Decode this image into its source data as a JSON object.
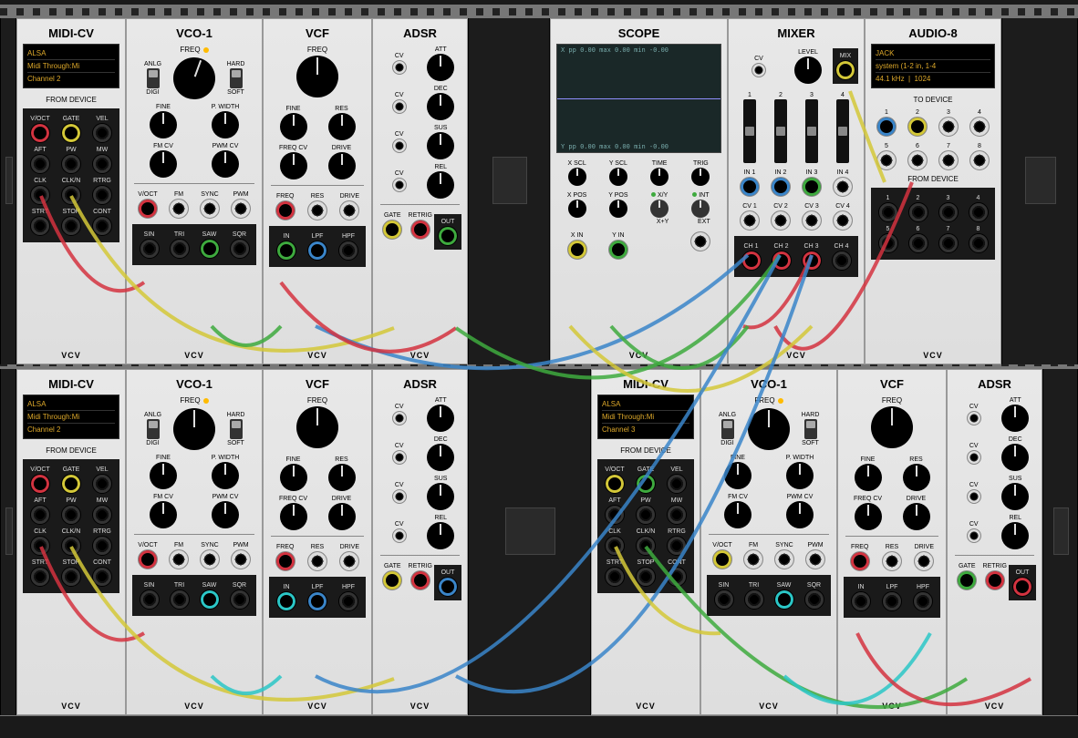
{
  "brand": "VCV",
  "labels": {
    "from_device": "FROM DEVICE",
    "to_device": "TO DEVICE",
    "freq": "FREQ",
    "fine": "FINE",
    "pwidth": "P. WIDTH",
    "fmcv": "FM CV",
    "pwmcv": "PWM CV",
    "anlg": "ANLG",
    "digi": "DIGI",
    "hard": "HARD",
    "soft": "SOFT",
    "voct": "V/OCT",
    "fm": "FM",
    "sync": "SYNC",
    "pwm": "PWM",
    "sin": "SIN",
    "tri": "TRI",
    "saw": "SAW",
    "sqr": "SQR",
    "res": "RES",
    "freqcv": "FREQ CV",
    "drive": "DRIVE",
    "in": "IN",
    "lpf": "LPF",
    "hpf": "HPF",
    "att": "ATT",
    "dec": "DEC",
    "sus": "SUS",
    "rel": "REL",
    "cv": "CV",
    "gate": "GATE",
    "retrig": "RETRIG",
    "out": "OUT",
    "xscl": "X SCL",
    "yscl": "Y SCL",
    "time": "TIME",
    "trig": "TRIG",
    "xpos": "X POS",
    "ypos": "Y POS",
    "xy": "X/Y",
    "int": "INT",
    "xplusy": "X+Y",
    "ext": "EXT",
    "xin": "X IN",
    "yin": "Y IN",
    "level": "LEVEL",
    "mix": "MIX",
    "in1": "IN 1",
    "in2": "IN 2",
    "in3": "IN 3",
    "in4": "IN 4",
    "cv1": "CV 1",
    "cv2": "CV 2",
    "cv3": "CV 3",
    "cv4": "CV 4",
    "ch1": "CH 1",
    "ch2": "CH 2",
    "ch3": "CH 3",
    "ch4": "CH 4"
  },
  "midi_cv": {
    "title": "MIDI-CV",
    "outs": [
      "V/OCT",
      "GATE",
      "VEL",
      "AFT",
      "PW",
      "MW",
      "CLK",
      "CLK/N",
      "RTRG",
      "STRT",
      "STOP",
      "CONT"
    ]
  },
  "midi_display_1": {
    "driver": "ALSA",
    "device": "Midi Through:Mi",
    "channel": "Channel 2"
  },
  "midi_display_3": {
    "driver": "ALSA",
    "device": "Midi Through:Mi",
    "channel": "Channel 3"
  },
  "vco": {
    "title": "VCO-1"
  },
  "vcf": {
    "title": "VCF"
  },
  "adsr": {
    "title": "ADSR"
  },
  "scope": {
    "title": "SCOPE",
    "x_info": "X   pp   0.00   max   0.00  min  -0.00",
    "y_info": "Y   pp   0.00   max   0.00  min  -0.00"
  },
  "mixer": {
    "title": "MIXER",
    "channels": [
      "1",
      "2",
      "3",
      "4"
    ]
  },
  "audio": {
    "title": "AUDIO-8",
    "driver": "JACK",
    "device": "system (1-2 in, 1-4",
    "rate": "44.1 kHz",
    "block": "1024",
    "outs": [
      "1",
      "2",
      "3",
      "4",
      "5",
      "6",
      "7",
      "8"
    ]
  }
}
